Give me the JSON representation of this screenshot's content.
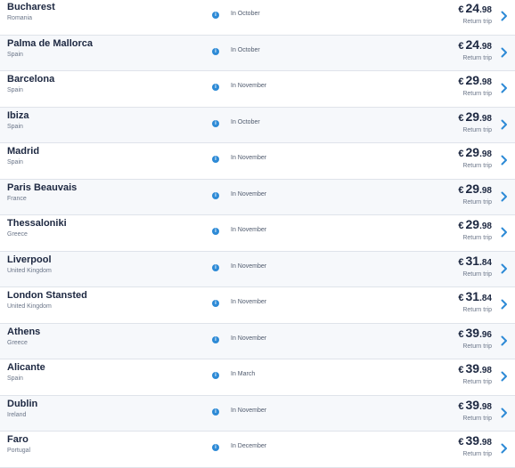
{
  "flights": [
    {
      "city": "Bucharest",
      "country": "Romania",
      "month": "In October",
      "currency": "€",
      "price_int": "24",
      "price_dec": ".98",
      "note": "Return trip"
    },
    {
      "city": "Palma de Mallorca",
      "country": "Spain",
      "month": "In October",
      "currency": "€",
      "price_int": "24",
      "price_dec": ".98",
      "note": "Return trip"
    },
    {
      "city": "Barcelona",
      "country": "Spain",
      "month": "In November",
      "currency": "€",
      "price_int": "29",
      "price_dec": ".98",
      "note": "Return trip"
    },
    {
      "city": "Ibiza",
      "country": "Spain",
      "month": "In October",
      "currency": "€",
      "price_int": "29",
      "price_dec": ".98",
      "note": "Return trip"
    },
    {
      "city": "Madrid",
      "country": "Spain",
      "month": "In November",
      "currency": "€",
      "price_int": "29",
      "price_dec": ".98",
      "note": "Return trip"
    },
    {
      "city": "Paris Beauvais",
      "country": "France",
      "month": "In November",
      "currency": "€",
      "price_int": "29",
      "price_dec": ".98",
      "note": "Return trip"
    },
    {
      "city": "Thessaloniki",
      "country": "Greece",
      "month": "In November",
      "currency": "€",
      "price_int": "29",
      "price_dec": ".98",
      "note": "Return trip"
    },
    {
      "city": "Liverpool",
      "country": "United Kingdom",
      "month": "In November",
      "currency": "€",
      "price_int": "31",
      "price_dec": ".84",
      "note": "Return trip"
    },
    {
      "city": "London Stansted",
      "country": "United Kingdom",
      "month": "In November",
      "currency": "€",
      "price_int": "31",
      "price_dec": ".84",
      "note": "Return trip"
    },
    {
      "city": "Athens",
      "country": "Greece",
      "month": "In November",
      "currency": "€",
      "price_int": "39",
      "price_dec": ".96",
      "note": "Return trip"
    },
    {
      "city": "Alicante",
      "country": "Spain",
      "month": "In March",
      "currency": "€",
      "price_int": "39",
      "price_dec": ".98",
      "note": "Return trip"
    },
    {
      "city": "Dublin",
      "country": "Ireland",
      "month": "In November",
      "currency": "€",
      "price_int": "39",
      "price_dec": ".98",
      "note": "Return trip"
    },
    {
      "city": "Faro",
      "country": "Portugal",
      "month": "In December",
      "currency": "€",
      "price_int": "39",
      "price_dec": ".98",
      "note": "Return trip"
    }
  ],
  "icons": {
    "info": "info-icon",
    "chevron": "chevron-right-icon"
  },
  "colors": {
    "accent": "#2d8ad6",
    "text": "#1c2740",
    "muted": "#6b7689",
    "row_alt": "#f6f8fb"
  }
}
